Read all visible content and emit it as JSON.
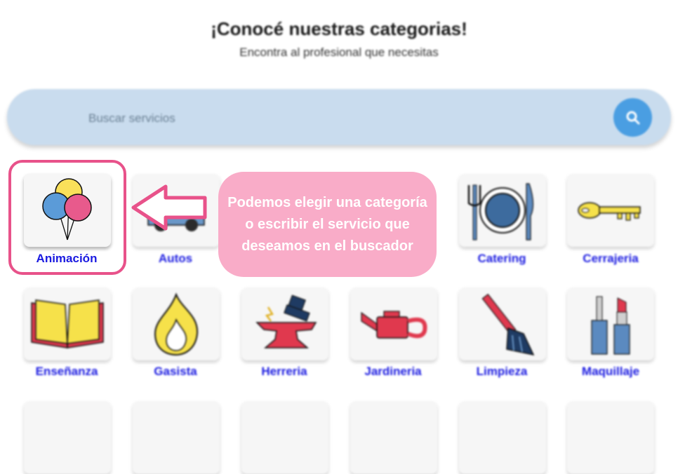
{
  "header": {
    "title": "¡Conocé nuestras categorias!",
    "subtitle": "Encontra al profesional que necesitas"
  },
  "search": {
    "placeholder": "Buscar servicios",
    "button_icon": "search-icon"
  },
  "categories": [
    {
      "label": "Animación",
      "icon": "balloons-icon"
    },
    {
      "label": "Autos",
      "icon": "car-icon"
    },
    {
      "label": "Catering",
      "icon": "plate-cutlery-icon"
    },
    {
      "label": "Cerrajeria",
      "icon": "key-icon"
    },
    {
      "label": "Enseñanza",
      "icon": "book-icon"
    },
    {
      "label": "Gasista",
      "icon": "flame-icon"
    },
    {
      "label": "Herreria",
      "icon": "anvil-hammer-icon"
    },
    {
      "label": "Jardineria",
      "icon": "watering-can-icon"
    },
    {
      "label": "Limpieza",
      "icon": "broom-icon"
    },
    {
      "label": "Maquillaje",
      "icon": "makeup-icon"
    }
  ],
  "tutorial": {
    "message": "Podemos elegir una categoría o escribir el servicio que deseamos en el buscador"
  },
  "colors": {
    "search_bar": "#c9dcee",
    "search_button": "#4a9ee2",
    "label": "#1a1ae0",
    "highlight": "#e8528a",
    "bubble": "#f9acc8"
  }
}
